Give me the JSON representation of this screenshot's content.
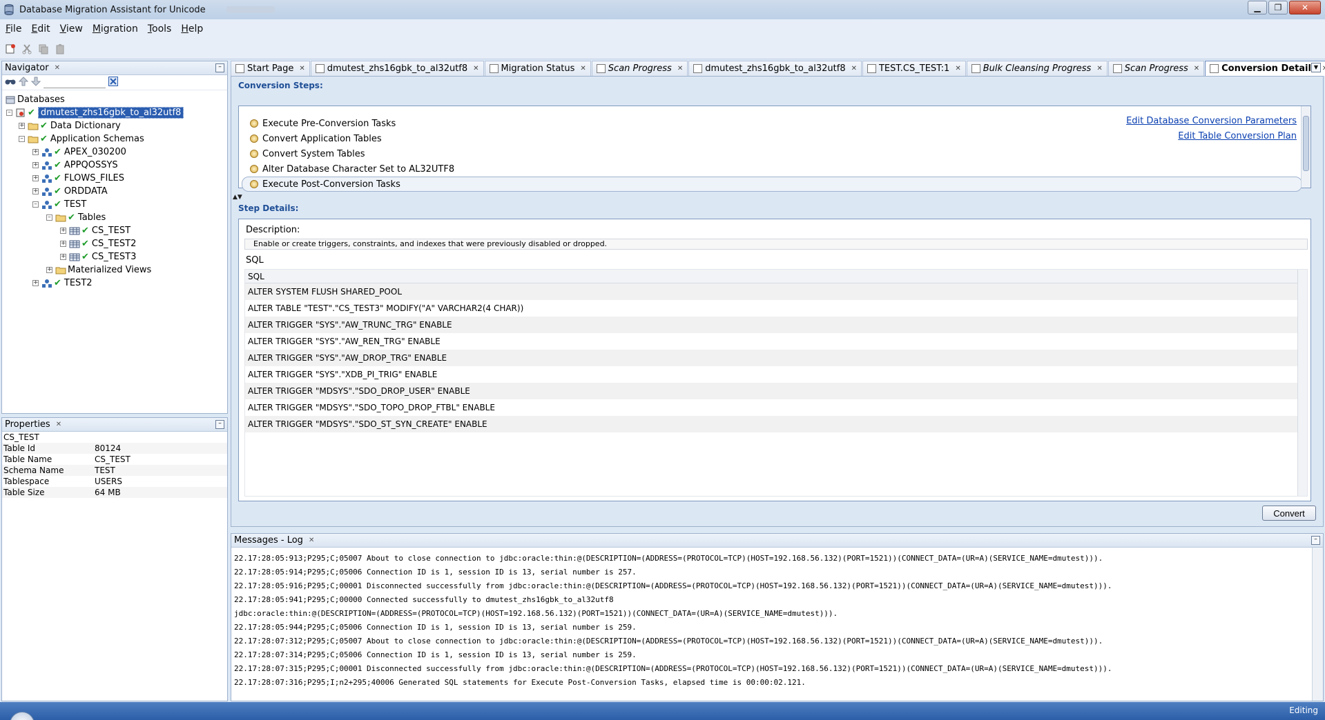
{
  "window": {
    "title": "Database Migration Assistant for Unicode",
    "controls": [
      "minimize",
      "restore",
      "close"
    ]
  },
  "menu": [
    "File",
    "Edit",
    "View",
    "Migration",
    "Tools",
    "Help"
  ],
  "toolbar_icons": [
    "new-connection-icon",
    "cut-icon",
    "copy-icon",
    "paste-icon"
  ],
  "navigator": {
    "title": "Navigator",
    "root_label": "Databases",
    "database": "dmutest_zhs16gbk_to_al32utf8",
    "data_dictionary": "Data Dictionary",
    "application_schemas": "Application Schemas",
    "schemas": [
      "APEX_030200",
      "APPQOSSYS",
      "FLOWS_FILES",
      "ORDDATA"
    ],
    "test_schema": "TEST",
    "tables_label": "Tables",
    "tables": [
      "CS_TEST",
      "CS_TEST2",
      "CS_TEST3"
    ],
    "materialized_views": "Materialized Views",
    "test2_schema": "TEST2"
  },
  "properties": {
    "title": "Properties",
    "object": "CS_TEST",
    "rows": [
      {
        "key": "Table Id",
        "value": "80124"
      },
      {
        "key": "Table Name",
        "value": "CS_TEST"
      },
      {
        "key": "Schema Name",
        "value": "TEST"
      },
      {
        "key": "Tablespace",
        "value": "USERS"
      },
      {
        "key": "Table Size",
        "value": "64 MB"
      }
    ]
  },
  "tabs": [
    {
      "label": "Start Page",
      "italic": false
    },
    {
      "label": "dmutest_zhs16gbk_to_al32utf8",
      "italic": false
    },
    {
      "label": "Migration Status",
      "italic": false
    },
    {
      "label": "Scan Progress",
      "italic": true
    },
    {
      "label": "dmutest_zhs16gbk_to_al32utf8",
      "italic": false
    },
    {
      "label": "TEST.CS_TEST:1",
      "italic": false
    },
    {
      "label": "Bulk Cleansing Progress",
      "italic": true
    },
    {
      "label": "Scan Progress",
      "italic": true
    },
    {
      "label": "Conversion Details",
      "italic": false,
      "active": true
    }
  ],
  "conversion": {
    "steps_label": "Conversion Steps:",
    "steps": [
      "Execute Pre-Conversion Tasks",
      "Convert Application Tables",
      "Convert System Tables",
      "Alter Database Character Set to AL32UTF8",
      "Execute Post-Conversion Tasks"
    ],
    "current_step": "Execute Post-Conversion Tasks",
    "link_params": "Edit Database Conversion Parameters",
    "link_plan": "Edit Table Conversion Plan",
    "details_label": "Step Details:",
    "description_label": "Description:",
    "description": "Enable or create triggers, constraints, and indexes that were previously disabled or dropped.",
    "sql_label": "SQL",
    "sql_header": "SQL",
    "sql_rows": [
      "ALTER SYSTEM FLUSH SHARED_POOL",
      "ALTER TABLE \"TEST\".\"CS_TEST3\" MODIFY(\"A\" VARCHAR2(4 CHAR))",
      "ALTER TRIGGER \"SYS\".\"AW_TRUNC_TRG\" ENABLE",
      "ALTER TRIGGER \"SYS\".\"AW_REN_TRG\" ENABLE",
      "ALTER TRIGGER \"SYS\".\"AW_DROP_TRG\" ENABLE",
      "ALTER TRIGGER \"SYS\".\"XDB_PI_TRIG\" ENABLE",
      "ALTER TRIGGER \"MDSYS\".\"SDO_DROP_USER\" ENABLE",
      "ALTER TRIGGER \"MDSYS\".\"SDO_TOPO_DROP_FTBL\" ENABLE",
      "ALTER TRIGGER \"MDSYS\".\"SDO_ST_SYN_CREATE\" ENABLE"
    ],
    "convert_button": "Convert"
  },
  "messages": {
    "title": "Messages - Log",
    "lines": [
      "22.17:28:05:913;P295;C;05007 About to close connection to jdbc:oracle:thin:@(DESCRIPTION=(ADDRESS=(PROTOCOL=TCP)(HOST=192.168.56.132)(PORT=1521))(CONNECT_DATA=(UR=A)(SERVICE_NAME=dmutest))).",
      "22.17:28:05:914;P295;C;05006 Connection ID is 1, session ID is 13, serial number is 257.",
      "22.17:28:05:916;P295;C;00001 Disconnected successfully from jdbc:oracle:thin:@(DESCRIPTION=(ADDRESS=(PROTOCOL=TCP)(HOST=192.168.56.132)(PORT=1521))(CONNECT_DATA=(UR=A)(SERVICE_NAME=dmutest))).",
      "22.17:28:05:941;P295;C;00000 Connected successfully to dmutest_zhs16gbk_to_al32utf8",
      "jdbc:oracle:thin:@(DESCRIPTION=(ADDRESS=(PROTOCOL=TCP)(HOST=192.168.56.132)(PORT=1521))(CONNECT_DATA=(UR=A)(SERVICE_NAME=dmutest))).",
      "22.17:28:05:944;P295;C;05006 Connection ID is 1, session ID is 13, serial number is 259.",
      "22.17:28:07:312;P295;C;05007 About to close connection to jdbc:oracle:thin:@(DESCRIPTION=(ADDRESS=(PROTOCOL=TCP)(HOST=192.168.56.132)(PORT=1521))(CONNECT_DATA=(UR=A)(SERVICE_NAME=dmutest))).",
      "22.17:28:07:314;P295;C;05006 Connection ID is 1, session ID is 13, serial number is 259.",
      "22.17:28:07:315;P295;C;00001 Disconnected successfully from jdbc:oracle:thin:@(DESCRIPTION=(ADDRESS=(PROTOCOL=TCP)(HOST=192.168.56.132)(PORT=1521))(CONNECT_DATA=(UR=A)(SERVICE_NAME=dmutest))).",
      "22.17:28:07:316;P295;I;n2+295;40006 Generated SQL statements for Execute Post-Conversion Tasks, elapsed time is 00:00:02.121."
    ]
  },
  "status": {
    "text": "Editing"
  },
  "colors": {
    "accent": "#2a5db0",
    "link": "#0a3fb0",
    "status_bar": "#2b5ea8",
    "check": "#1f9c2a",
    "section_label": "#1f4f96"
  }
}
